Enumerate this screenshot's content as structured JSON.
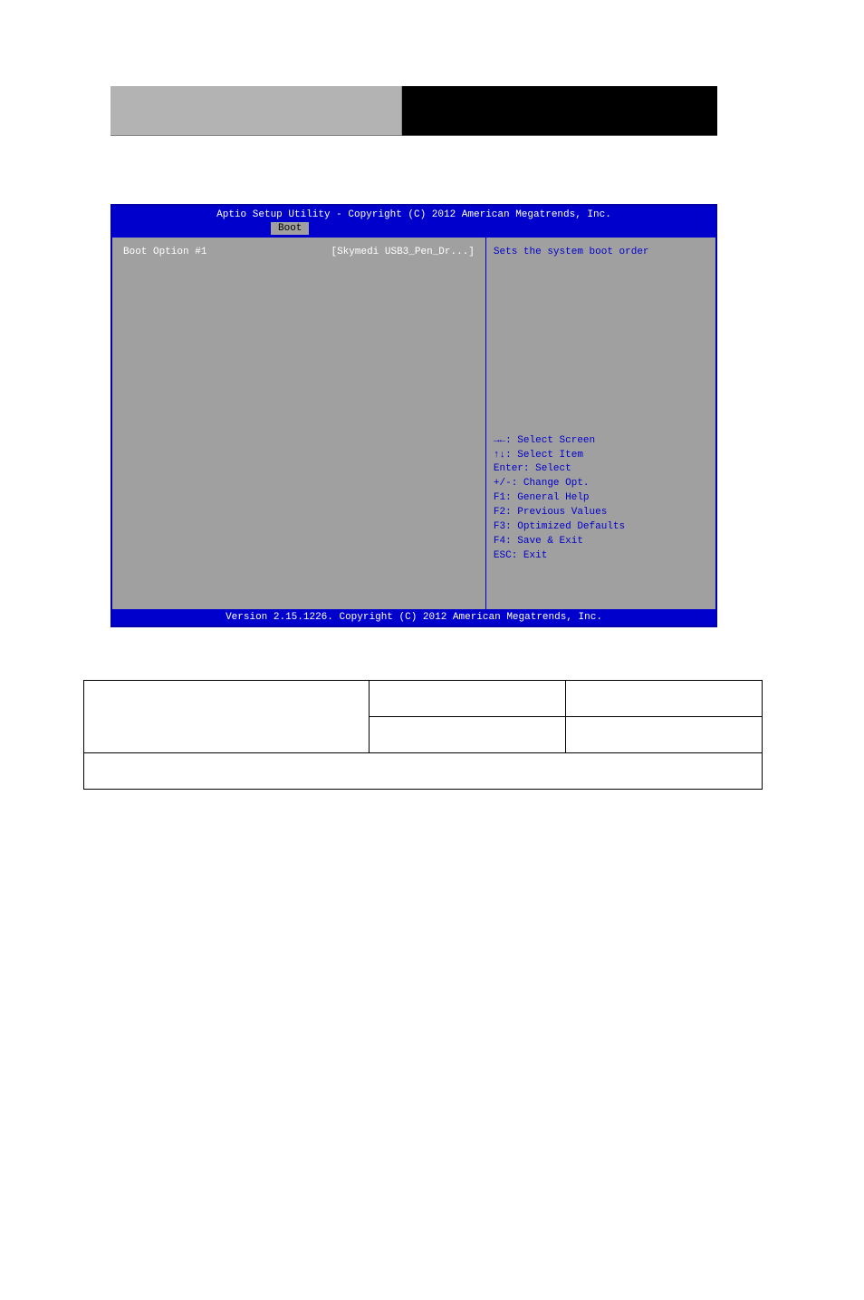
{
  "bios": {
    "title": "Aptio Setup Utility - Copyright (C) 2012 American Megatrends, Inc.",
    "activeTab": "Boot",
    "setting": {
      "label": "Boot Option #1",
      "value": "[Skymedi USB3_Pen_Dr...]"
    },
    "helpTop": "Sets the system boot order",
    "helpKeys": {
      "selectScreen": "→←: Select Screen",
      "selectItem": "↑↓: Select Item",
      "enter": "Enter: Select",
      "changeOpt": "+/-: Change Opt.",
      "f1": "F1: General Help",
      "f2": "F2: Previous Values",
      "f3": "F3: Optimized Defaults",
      "f4": "F4: Save & Exit",
      "esc": "ESC: Exit"
    },
    "footer": "Version 2.15.1226. Copyright (C) 2012 American Megatrends, Inc."
  }
}
